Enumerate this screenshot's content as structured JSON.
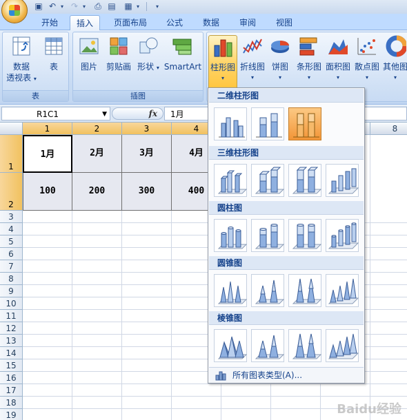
{
  "tabs": [
    "开始",
    "插入",
    "页面布局",
    "公式",
    "数据",
    "审阅",
    "视图"
  ],
  "ribbon": {
    "groups": {
      "table": "表",
      "illustrations": "插图"
    },
    "buttons": {
      "pivot_line1": "数据",
      "pivot_line2": "透视表",
      "table": "表",
      "picture": "图片",
      "clipart": "剪贴画",
      "shapes": "形状",
      "smartart": "SmartArt",
      "column": "柱形图",
      "line": "折线图",
      "pie": "饼图",
      "bar": "条形图",
      "area": "面积图",
      "scatter": "散点图",
      "other": "其他图"
    }
  },
  "formula_bar": {
    "name_box": "R1C1",
    "fx": "fx",
    "value": "1月"
  },
  "grid": {
    "col_headers": [
      "1",
      "2",
      "3",
      "4",
      "8"
    ],
    "row_headers": [
      "1",
      "2",
      "3",
      "4",
      "5",
      "6",
      "7",
      "8",
      "9",
      "10",
      "11",
      "12",
      "13",
      "14",
      "15",
      "16",
      "17",
      "18",
      "19"
    ],
    "row1": [
      "1月",
      "2月",
      "3月",
      "4月"
    ],
    "row2": [
      "100",
      "200",
      "300",
      "400"
    ]
  },
  "dropdown": {
    "sections": [
      "二维柱形图",
      "三维柱形图",
      "圆柱图",
      "圆锥图",
      "棱锥图"
    ],
    "footer": "所有图表类型(A)..."
  },
  "watermark": "Baidu经验",
  "colors": {
    "ribbon_bg": "#c8dbf3",
    "header_selected": "#f1c15f",
    "thumb_selected": "#f29537",
    "accent_text": "#15428b"
  }
}
